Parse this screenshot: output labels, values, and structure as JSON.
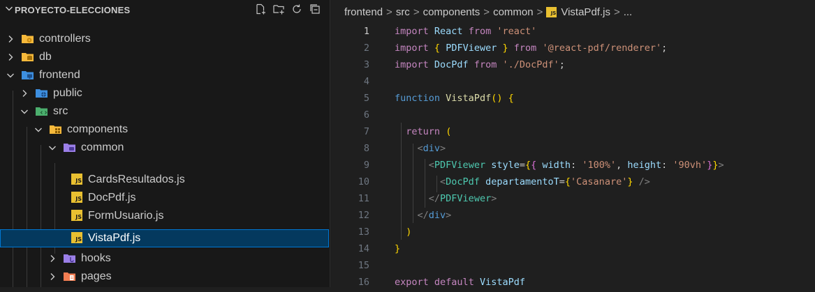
{
  "explorer": {
    "title": "PROYECTO-ELECCIONES",
    "actions": [
      "new-file-icon",
      "new-folder-icon",
      "refresh-icon",
      "collapse-all-icon"
    ],
    "items": [
      {
        "label": "controllers",
        "kind": "folder",
        "expanded": false,
        "depth": 0,
        "icon": "controllers-folder-icon"
      },
      {
        "label": "db",
        "kind": "folder",
        "expanded": false,
        "depth": 0,
        "icon": "db-folder-icon"
      },
      {
        "label": "frontend",
        "kind": "folder",
        "expanded": true,
        "depth": 0,
        "icon": "frontend-folder-icon"
      },
      {
        "label": "public",
        "kind": "folder",
        "expanded": false,
        "depth": 1,
        "icon": "public-folder-icon"
      },
      {
        "label": "src",
        "kind": "folder",
        "expanded": true,
        "depth": 1,
        "icon": "src-folder-icon"
      },
      {
        "label": "components",
        "kind": "folder",
        "expanded": true,
        "depth": 2,
        "icon": "components-folder-icon"
      },
      {
        "label": "common",
        "kind": "folder",
        "expanded": true,
        "depth": 3,
        "icon": "common-folder-icon"
      },
      {
        "label": "CardsResultados.js",
        "kind": "file",
        "depth": 4,
        "icon": "js-file-icon"
      },
      {
        "label": "DocPdf.js",
        "kind": "file",
        "depth": 4,
        "icon": "js-file-icon"
      },
      {
        "label": "FormUsuario.js",
        "kind": "file",
        "depth": 4,
        "icon": "js-file-icon"
      },
      {
        "label": "VistaPdf.js",
        "kind": "file",
        "depth": 4,
        "icon": "js-file-icon",
        "selected": true
      },
      {
        "label": "hooks",
        "kind": "folder",
        "expanded": false,
        "depth": 3,
        "icon": "hooks-folder-icon"
      },
      {
        "label": "pages",
        "kind": "folder",
        "expanded": false,
        "depth": 3,
        "icon": "pages-folder-icon"
      }
    ]
  },
  "editor": {
    "breadcrumb": [
      "frontend",
      "src",
      "components",
      "common",
      "VistaPdf.js",
      "..."
    ],
    "file_badge": "JS",
    "active_line": 1,
    "lines": [
      {
        "n": "1",
        "text": "import React from 'react'"
      },
      {
        "n": "2",
        "text": "import { PDFViewer } from '@react-pdf/renderer';"
      },
      {
        "n": "3",
        "text": "import DocPdf from './DocPdf';"
      },
      {
        "n": "4",
        "text": ""
      },
      {
        "n": "5",
        "text": "function VistaPdf() {"
      },
      {
        "n": "6",
        "text": ""
      },
      {
        "n": "7",
        "text": "  return ("
      },
      {
        "n": "8",
        "text": "    <div>"
      },
      {
        "n": "9",
        "text": "      <PDFViewer style={{ width: '100%', height: '90vh'}}>"
      },
      {
        "n": "10",
        "text": "        <DocPdf departamentoT={'Casanare'} />"
      },
      {
        "n": "11",
        "text": "      </PDFViewer>"
      },
      {
        "n": "12",
        "text": "    </div>"
      },
      {
        "n": "13",
        "text": "  )"
      },
      {
        "n": "14",
        "text": "}"
      },
      {
        "n": "15",
        "text": ""
      },
      {
        "n": "16",
        "text": "export default VistaPdf"
      }
    ]
  },
  "colors": {
    "sidebar_bg": "#181818",
    "editor_bg": "#1f1f1f",
    "selection_bg": "#04395e",
    "selection_border": "#0078d4",
    "js_badge": "#e9c031"
  }
}
